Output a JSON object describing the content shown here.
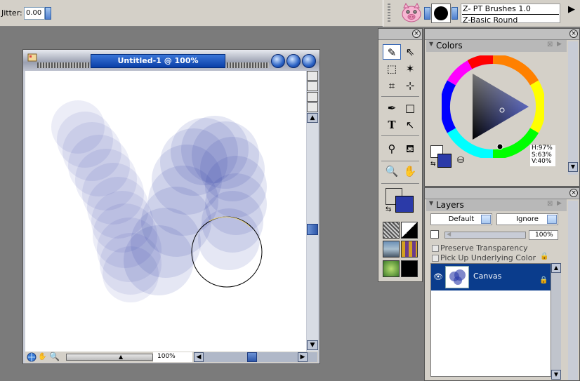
{
  "property_bar": {
    "jitter_label": "Jitter:",
    "jitter_value": "0.00"
  },
  "brush_selector": {
    "category": "Z- PT Brushes 1.0",
    "variant": "Z-Basic Round",
    "expand_icon": "triangle-right-icon"
  },
  "document": {
    "title": "Untitled-1 @ 100%",
    "zoom": "100%"
  },
  "colors_panel": {
    "title": "Colors",
    "hsv": {
      "h": "H:97%",
      "s": "S:63%",
      "v": "V:40%"
    },
    "main_color": "#2b3aa8",
    "secondary_color": "#ffffff"
  },
  "layers_panel": {
    "title": "Layers",
    "composite_method": "Default",
    "composite_depth": "Ignore",
    "opacity": "100%",
    "preserve_transparency_label": "Preserve Transparency",
    "pick_up_underlying_label": "Pick Up Underlying Color",
    "layers": [
      {
        "name": "Canvas"
      }
    ]
  },
  "colors": {
    "accent": "#0a3c8c",
    "stroke": "#2b3aa8",
    "panel_bg": "#d4d0c8"
  }
}
